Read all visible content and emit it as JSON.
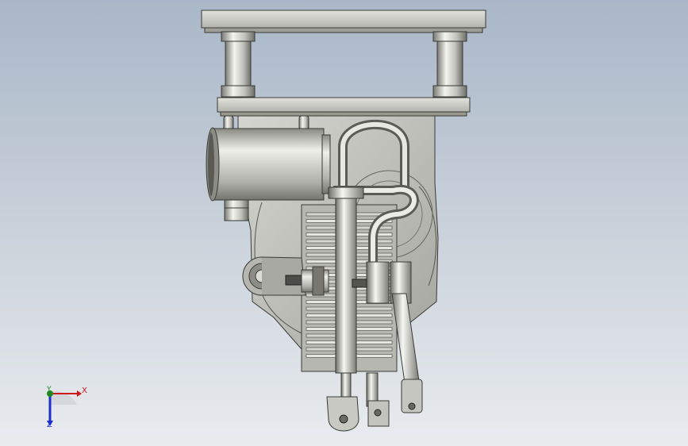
{
  "viewport": {
    "background_top": "#a9b7c8",
    "background_bottom": "#e9ecef",
    "model_color": "#c8c8c2"
  },
  "triad": {
    "x_label": "X",
    "y_label": "Y",
    "z_label": "Z",
    "x_color": "#d01818",
    "y_color": "#1d8a1d",
    "z_color": "#1b2fd0"
  }
}
